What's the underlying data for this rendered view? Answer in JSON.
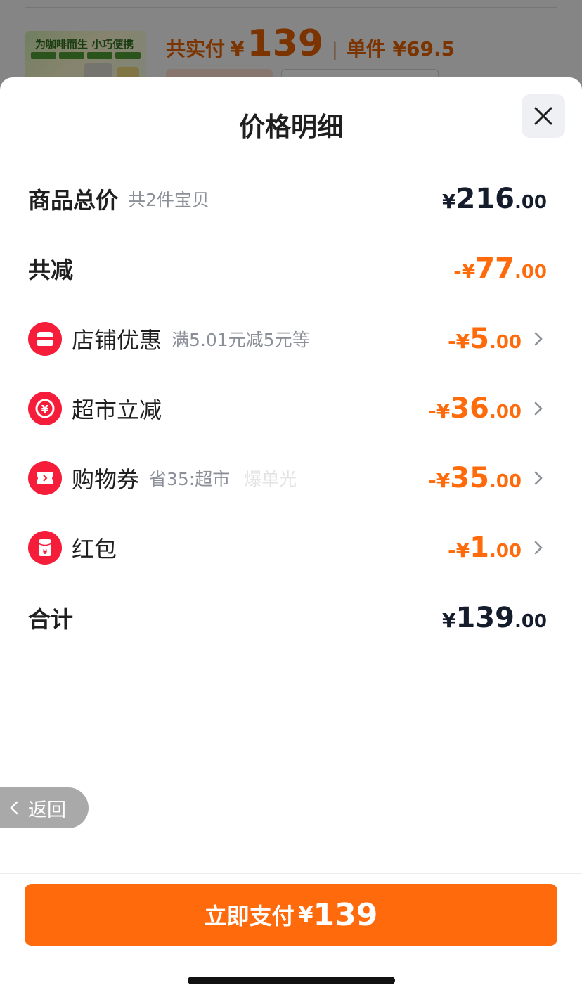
{
  "background": {
    "thumb_title": "为咖啡而生 小巧便携",
    "price_label": "共实付",
    "price_currency": "¥",
    "price_value": "139",
    "separator": "|",
    "unit_price": "单件 ¥69.5"
  },
  "sheet": {
    "title": "价格明细",
    "rows": [
      {
        "label": "商品总价",
        "sub": "共2件宝贝",
        "sign": "¥",
        "int": "216",
        "dec": ".00"
      },
      {
        "label": "共减",
        "sign": "-¥",
        "int": "77",
        "dec": ".00"
      },
      {
        "label": "店铺优惠",
        "sub": "满5.01元减5元等",
        "sign": "-¥",
        "int": "5",
        "dec": ".00",
        "icon": "store-coupon-icon"
      },
      {
        "label": "超市立减",
        "sign": "-¥",
        "int": "36",
        "dec": ".00",
        "icon": "yuan-discount-icon"
      },
      {
        "label": "购物券",
        "sub": "省35:超市",
        "faint": "爆单光",
        "sign": "-¥",
        "int": "35",
        "dec": ".00",
        "icon": "ticket-icon"
      },
      {
        "label": "红包",
        "sign": "-¥",
        "int": "1",
        "dec": ".00",
        "icon": "red-packet-icon"
      },
      {
        "label": "合计",
        "sign": "¥",
        "int": "139",
        "dec": ".00"
      }
    ]
  },
  "back_button": {
    "label": "返回"
  },
  "pay_button": {
    "label": "立即支付",
    "currency": "¥",
    "amount": "139"
  },
  "colors": {
    "accent": "#ff6b0c",
    "discount": "#ff6a0a",
    "icon_red": "#f51d3a",
    "text_dark": "#151c2c"
  }
}
